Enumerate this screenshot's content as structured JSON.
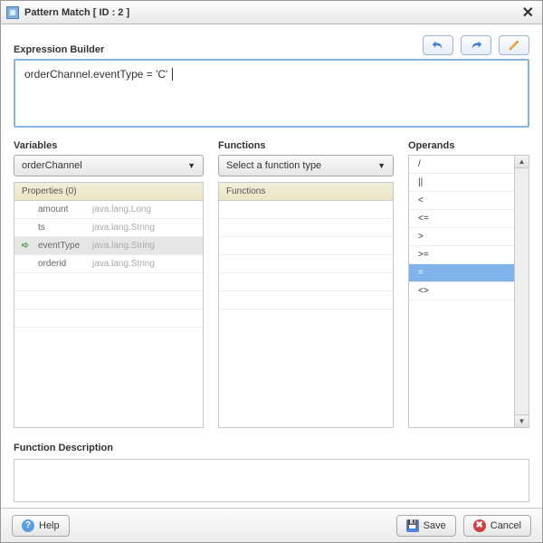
{
  "window": {
    "title": "Pattern Match [ ID : 2 ]"
  },
  "expression": {
    "label": "Expression Builder",
    "value": "orderChannel.eventType = 'C'"
  },
  "toolbar": {
    "undo_icon": "undo-icon",
    "redo_icon": "redo-icon",
    "edit_icon": "pencil-icon"
  },
  "variables": {
    "label": "Variables",
    "selected": "orderChannel",
    "gridTitle": "Properties (0)",
    "rows": [
      {
        "arrow": "",
        "name": "amount",
        "type": "java.lang.Long",
        "selected": false
      },
      {
        "arrow": "",
        "name": "ts",
        "type": "java.lang.String",
        "selected": false
      },
      {
        "arrow": "➪",
        "name": "eventType",
        "type": "java.lang.String",
        "selected": true
      },
      {
        "arrow": "",
        "name": "orderid",
        "type": "java.lang.String",
        "selected": false
      }
    ]
  },
  "functions": {
    "label": "Functions",
    "selected": "Select a function type",
    "gridTitle": "Functions"
  },
  "operands": {
    "label": "Operands",
    "list": [
      {
        "sym": "/",
        "selected": false
      },
      {
        "sym": "||",
        "selected": false
      },
      {
        "sym": "<",
        "selected": false
      },
      {
        "sym": "<=",
        "selected": false
      },
      {
        "sym": ">",
        "selected": false
      },
      {
        "sym": ">=",
        "selected": false
      },
      {
        "sym": "=",
        "selected": true
      },
      {
        "sym": "<>",
        "selected": false
      }
    ]
  },
  "description": {
    "label": "Function Description"
  },
  "footer": {
    "help": "Help",
    "save": "Save",
    "cancel": "Cancel"
  }
}
